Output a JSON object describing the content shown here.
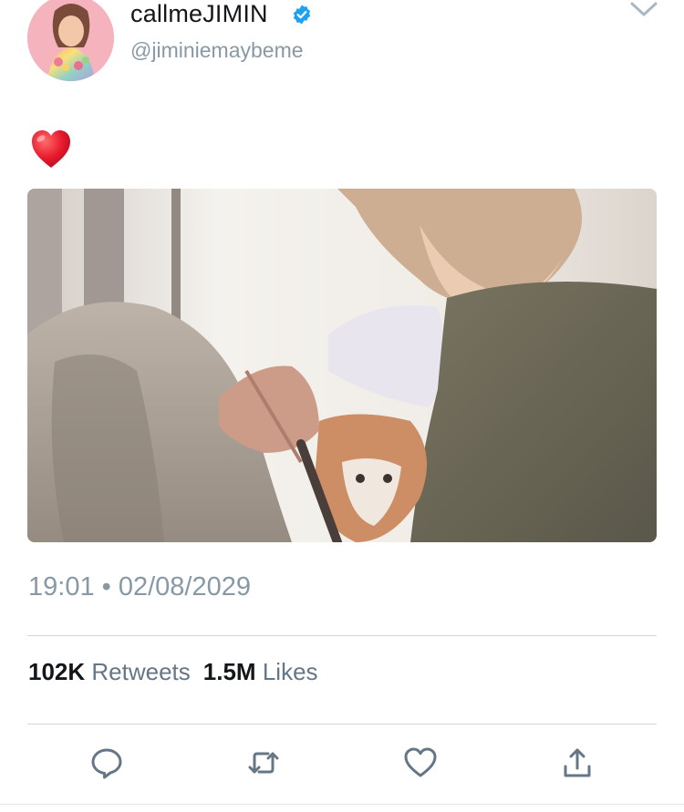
{
  "user": {
    "display_name": "callmeJIMIN",
    "handle": "@jiminiemaybeme",
    "verified": true
  },
  "tweet": {
    "text_emoji": "red-heart-emoji",
    "media": "photo of person smiling and holding a cat near a window"
  },
  "meta": {
    "time": "19:01",
    "separator": "•",
    "date": "02/08/2029"
  },
  "stats": {
    "retweets_count": "102K",
    "retweets_label": "Retweets",
    "likes_count": "1.5M",
    "likes_label": "Likes"
  },
  "actions": [
    {
      "icon": "reply-icon"
    },
    {
      "icon": "retweet-icon"
    },
    {
      "icon": "like-icon"
    },
    {
      "icon": "share-icon"
    }
  ],
  "colors": {
    "text_primary": "#14171a",
    "text_secondary": "#8899a6",
    "verified_blue": "#1da1f2",
    "heart_red": "#e0245e"
  }
}
